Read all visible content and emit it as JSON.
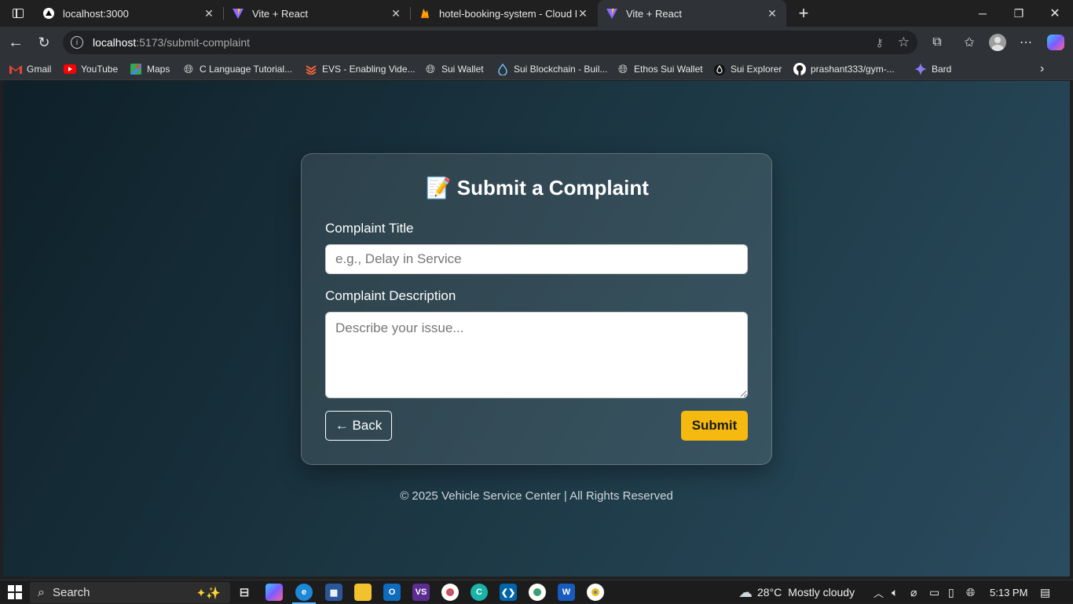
{
  "browser": {
    "tabs": [
      {
        "title": "localhost:3000"
      },
      {
        "title": "Vite + React"
      },
      {
        "title": "hotel-booking-system - Cloud Fir"
      },
      {
        "title": "Vite + React"
      }
    ],
    "url_host": "localhost",
    "url_path": ":5173/submit-complaint"
  },
  "bookmarks": [
    {
      "label": "Gmail",
      "icon": "gmail-icon"
    },
    {
      "label": "YouTube",
      "icon": "youtube-icon"
    },
    {
      "label": "Maps",
      "icon": "maps-icon"
    },
    {
      "label": "C Language Tutorial...",
      "icon": "globe-icon"
    },
    {
      "label": "EVS - Enabling Vide...",
      "icon": "evs-icon"
    },
    {
      "label": "Sui Wallet",
      "icon": "globe-icon"
    },
    {
      "label": "Sui Blockchain - Buil...",
      "icon": "sui-drop-icon"
    },
    {
      "label": "Ethos Sui Wallet",
      "icon": "globe-icon"
    },
    {
      "label": "Sui Explorer",
      "icon": "sui-drop-icon"
    },
    {
      "label": "prashant333/gym-...",
      "icon": "github-icon"
    },
    {
      "label": "Bard",
      "icon": "bard-icon"
    }
  ],
  "page": {
    "heading_icon": "📝",
    "heading": "Submit a Complaint",
    "title_label": "Complaint Title",
    "title_placeholder": "e.g., Delay in Service",
    "desc_label": "Complaint Description",
    "desc_placeholder": "Describe your issue...",
    "back_label": "← Back",
    "submit_label": "Submit",
    "footer": "© 2025 Vehicle Service Center | All Rights Reserved"
  },
  "taskbar": {
    "search_label": "Search",
    "weather_temp": "28°C",
    "weather_desc": "Mostly cloudy",
    "time": "5:13 PM"
  },
  "colors": {
    "submit_bg": "#f5b90f",
    "page_gradient_start": "#0e2029",
    "page_gradient_end": "#2a4c5f"
  }
}
